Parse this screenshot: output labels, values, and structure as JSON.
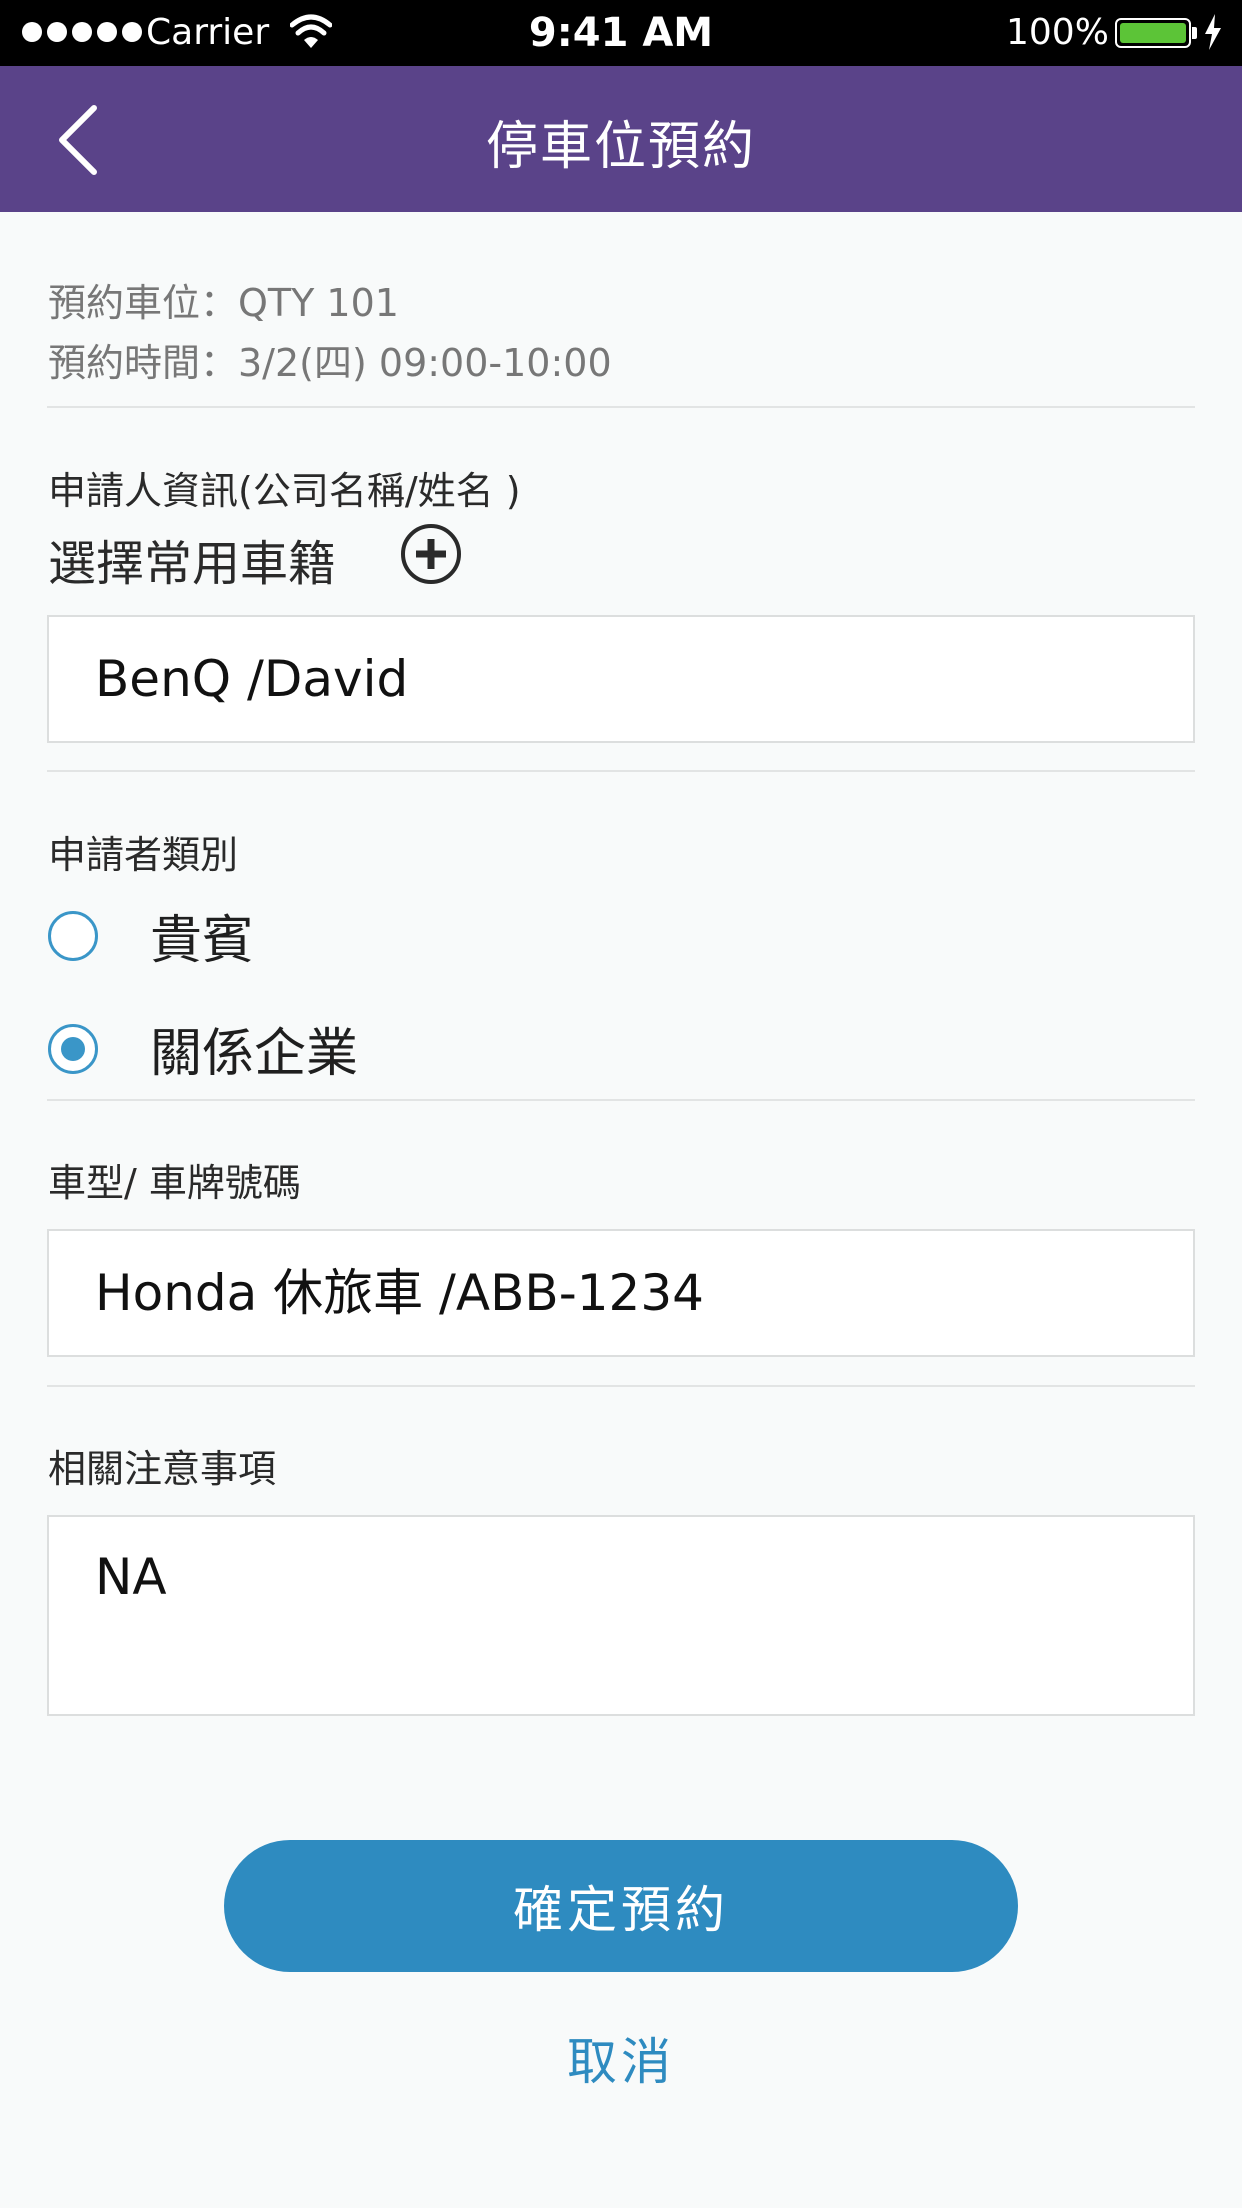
{
  "status_bar": {
    "carrier": "Carrier",
    "time": "9:41 AM",
    "battery": "100%"
  },
  "nav": {
    "title": "停車位預約",
    "back_icon": "chevron-left-icon"
  },
  "reservation": {
    "space_line": "預約車位：QTY  101",
    "time_line": "預約時間：3/2(四)  09:00-10:00"
  },
  "applicant": {
    "label": "申請人資訊(公司名稱/姓名 )",
    "choose_label": "選擇常用車籍",
    "add_icon": "plus-circle-icon",
    "value": "BenQ /David"
  },
  "category": {
    "label": "申請者類別",
    "options": [
      {
        "label": "貴賓",
        "checked": false
      },
      {
        "label": "關係企業",
        "checked": true
      }
    ]
  },
  "vehicle": {
    "label": "車型/ 車牌號碼",
    "value": "Honda 休旅車 /ABB-1234"
  },
  "notes": {
    "label": "相關注意事項",
    "value": "NA"
  },
  "actions": {
    "confirm": "確定預約",
    "cancel": "取消"
  },
  "colors": {
    "nav_bg": "#5a4389",
    "accent": "#2e8bc0",
    "battery": "#5cc437"
  }
}
